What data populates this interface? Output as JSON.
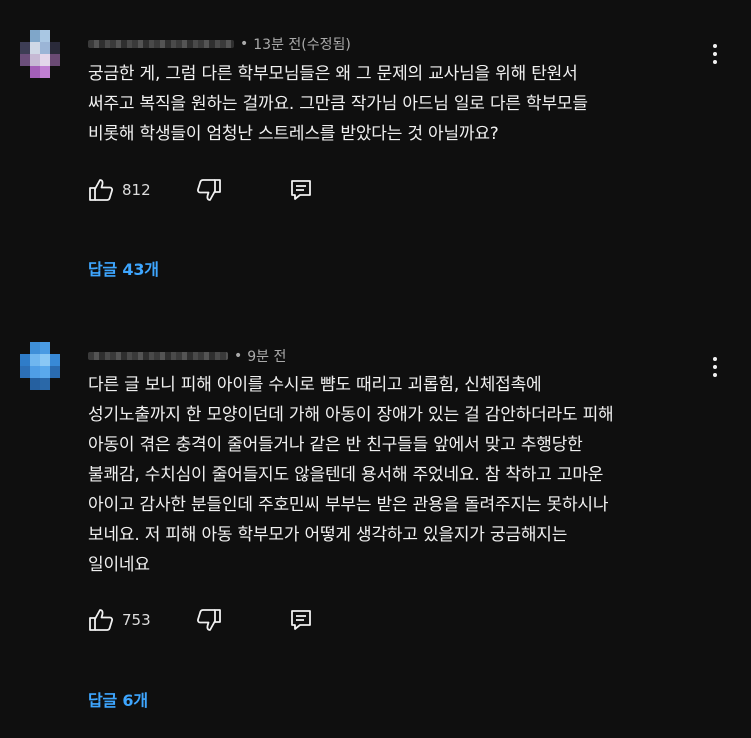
{
  "comments": [
    {
      "author_hidden": true,
      "timestamp": "13분 전(수정됨)",
      "text": "궁금한 게, 그럼 다른 학부모님들은 왜 그 문제의 교사님을 위해 탄원서\n써주고 복직을 원하는 걸까요. 그만큼 작가님 아드님 일로 다른 학부모들\n비롯해 학생들이 엄청난 스트레스를 받았다는 것 아닐까요?",
      "likes": "812",
      "replies_label": "답글 43개",
      "icons": [
        "like-icon",
        "dislike-icon",
        "reply-icon",
        "more-vert-icon"
      ]
    },
    {
      "author_hidden": true,
      "timestamp": "9분 전",
      "text": "다른 글 보니 피해 아이를 수시로 뺨도 때리고 괴롭힘, 신체접촉에\n성기노출까지 한 모양이던데 가해 아동이 장애가 있는 걸 감안하더라도 피해\n아동이 겪은 충격이 줄어들거나 같은 반 친구들들 앞에서 맞고 추행당한\n불쾌감, 수치심이 줄어들지도 않을텐데 용서해 주었네요. 참 착하고 고마운\n아이고 감사한 분들인데 주호민씨 부부는 받은 관용을 돌려주지는 못하시나\n보네요. 저 피해 아동 학부모가 어떻게 생각하고 있을지가 궁금해지는\n일이네요",
      "likes": "753",
      "replies_label": "답글 6개",
      "icons": [
        "like-icon",
        "dislike-icon",
        "reply-icon",
        "more-vert-icon"
      ]
    }
  ],
  "colors": {
    "background": "#0f0f0f",
    "text": "#f1f1f1",
    "secondary_text": "#aaaaaa",
    "link": "#3ea6ff"
  }
}
